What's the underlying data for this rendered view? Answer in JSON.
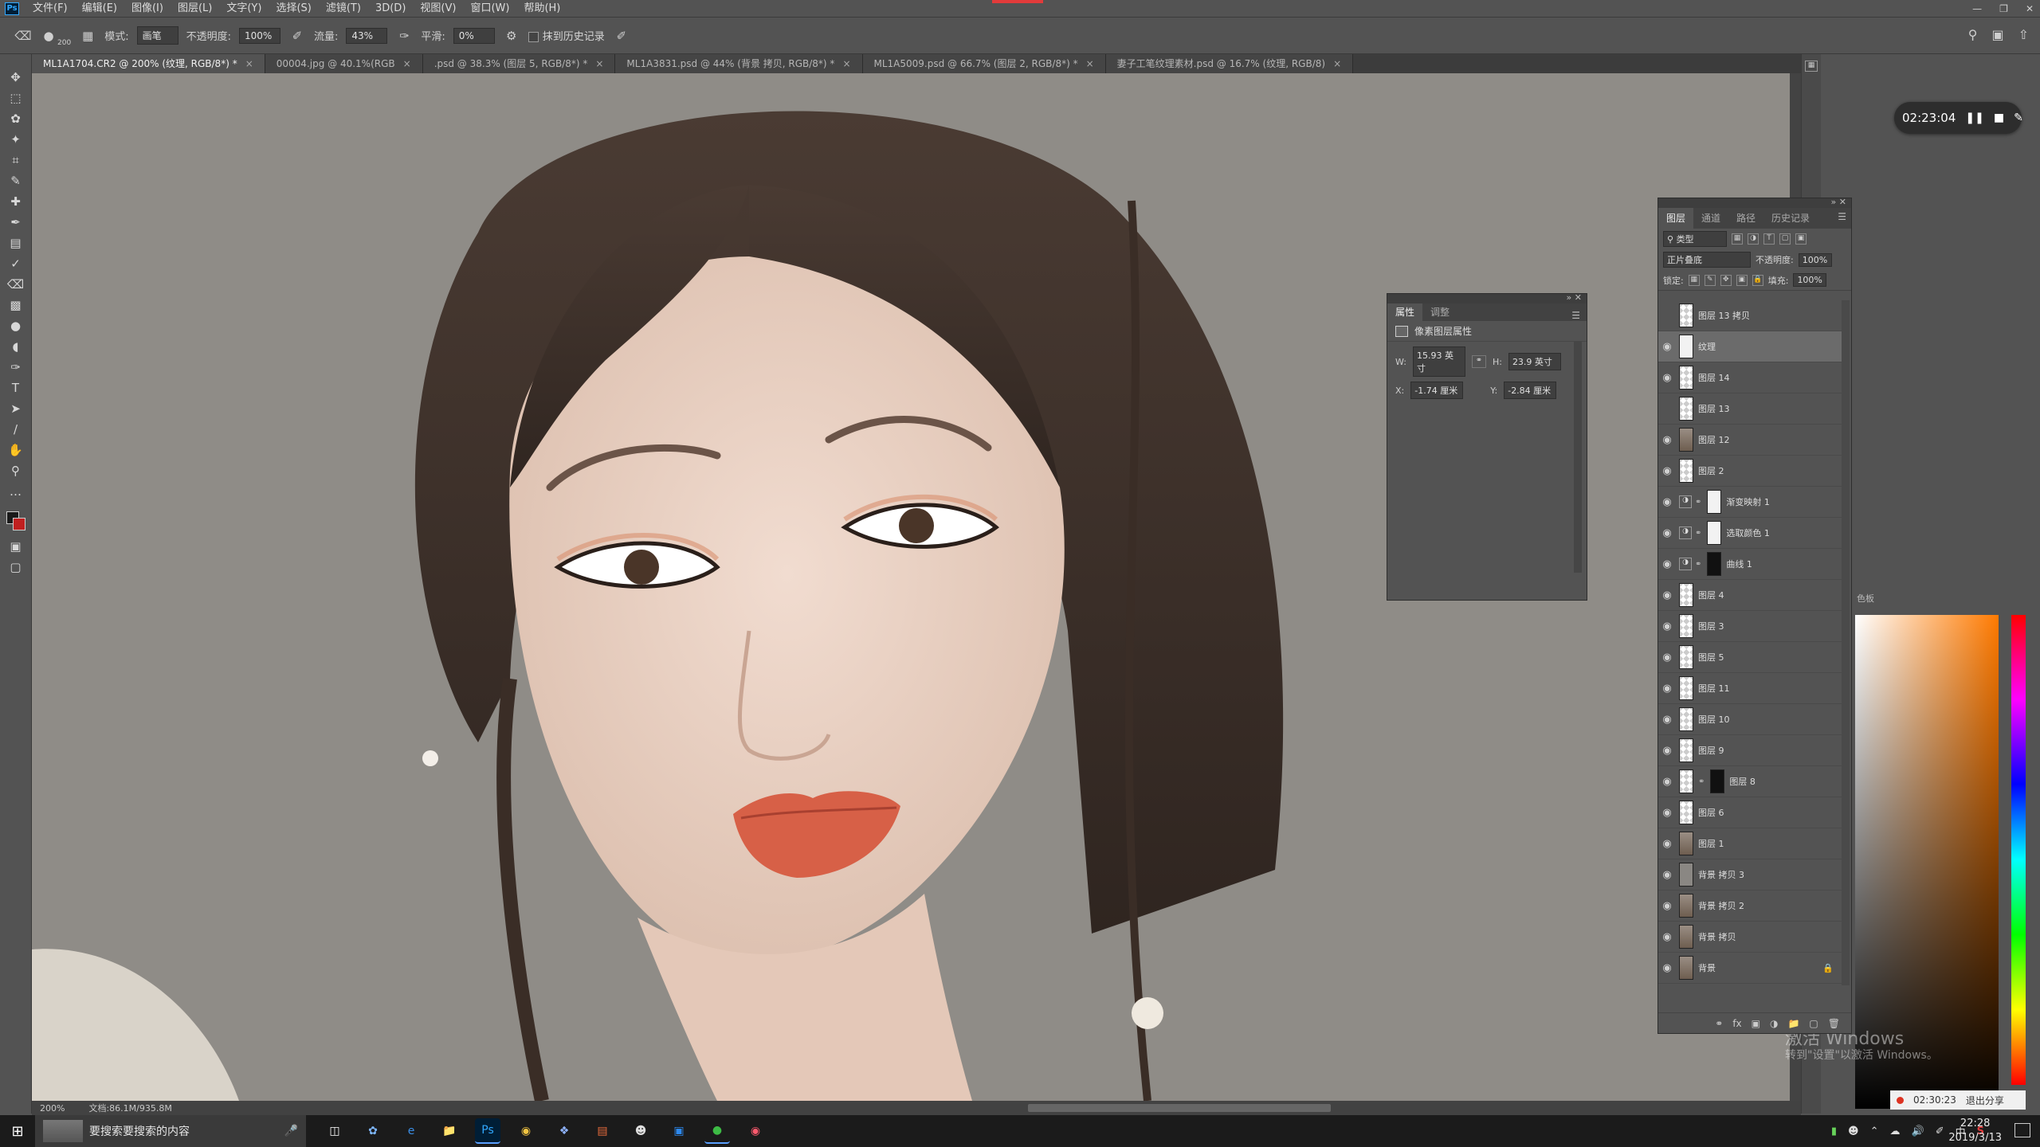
{
  "app": {
    "logo_text": "Ps",
    "menu": [
      "文件(F)",
      "编辑(E)",
      "图像(I)",
      "图层(L)",
      "文字(Y)",
      "选择(S)",
      "滤镜(T)",
      "3D(D)",
      "视图(V)",
      "窗口(W)",
      "帮助(H)"
    ]
  },
  "options": {
    "brush_size": "200",
    "mode_label": "模式:",
    "mode_value": "画笔",
    "opacity_label": "不透明度:",
    "opacity_value": "100%",
    "flow_label": "流量:",
    "flow_value": "43%",
    "smooth_label": "平滑:",
    "smooth_value": "0%",
    "history_label": "抹到历史记录"
  },
  "tabs": [
    {
      "label": "ML1A1704.CR2 @ 200% (纹理, RGB/8*) *",
      "active": true
    },
    {
      "label": "00004.jpg @ 40.1%(RGB",
      "active": false
    },
    {
      "label": ".psd @ 38.3% (图层 5, RGB/8*) *",
      "active": false
    },
    {
      "label": "ML1A3831.psd @ 44% (背景 拷贝, RGB/8*) *",
      "active": false
    },
    {
      "label": "ML1A5009.psd @ 66.7% (图层 2, RGB/8*) *",
      "active": false
    },
    {
      "label": "妻子工笔纹理素材.psd @ 16.7% (纹理, RGB/8)",
      "active": false
    }
  ],
  "status": {
    "zoom": "200%",
    "doc": "文档:86.1M/935.8M"
  },
  "properties": {
    "tab_props": "属性",
    "tab_adjust": "调整",
    "header": "像素图层属性",
    "w_label": "W:",
    "w_value": "15.93 英寸",
    "h_label": "H:",
    "h_value": "23.9 英寸",
    "x_label": "X:",
    "x_value": "-1.74 厘米",
    "y_label": "Y:",
    "y_value": "-2.84 厘米"
  },
  "layers_panel": {
    "tabs": [
      "图层",
      "通道",
      "路径",
      "历史记录"
    ],
    "filter_label": "类型",
    "blend_mode": "正片叠底",
    "opacity_label": "不透明度:",
    "opacity_value": "100%",
    "lock_label": "锁定:",
    "fill_label": "填充:",
    "fill_value": "100%",
    "layers": [
      {
        "name": "图层 13 拷贝",
        "visible": false,
        "thumb": "checker"
      },
      {
        "name": "纹理",
        "visible": true,
        "thumb": "white",
        "selected": true
      },
      {
        "name": "图层 14",
        "visible": true,
        "thumb": "checker"
      },
      {
        "name": "图层 13",
        "visible": false,
        "thumb": "checker"
      },
      {
        "name": "图层 12",
        "visible": true,
        "thumb": "photo"
      },
      {
        "name": "图层 2",
        "visible": true,
        "thumb": "checker"
      },
      {
        "name": "渐变映射 1",
        "visible": true,
        "thumb": "white",
        "adjust": "gradient"
      },
      {
        "name": "选取颜色 1",
        "visible": true,
        "thumb": "white",
        "adjust": "selective"
      },
      {
        "name": "曲线 1",
        "visible": true,
        "thumb": "black",
        "adjust": "curves"
      },
      {
        "name": "图层 4",
        "visible": true,
        "thumb": "checker"
      },
      {
        "name": "图层 3",
        "visible": true,
        "thumb": "checker"
      },
      {
        "name": "图层 5",
        "visible": true,
        "thumb": "checker"
      },
      {
        "name": "图层 11",
        "visible": true,
        "thumb": "checker"
      },
      {
        "name": "图层 10",
        "visible": true,
        "thumb": "checker"
      },
      {
        "name": "图层 9",
        "visible": true,
        "thumb": "checker"
      },
      {
        "name": "图层 8",
        "visible": true,
        "thumb": "checker",
        "mask": true
      },
      {
        "name": "图层 6",
        "visible": true,
        "thumb": "checker"
      },
      {
        "name": "图层 1",
        "visible": true,
        "thumb": "photo"
      },
      {
        "name": "背景 拷贝 3",
        "visible": true,
        "thumb": "gray"
      },
      {
        "name": "背景 拷贝 2",
        "visible": true,
        "thumb": "photo"
      },
      {
        "name": "背景 拷贝",
        "visible": true,
        "thumb": "photo"
      },
      {
        "name": "背景",
        "visible": true,
        "thumb": "photo",
        "locked": true
      }
    ]
  },
  "color_panel": {
    "label": "色板"
  },
  "recorder": {
    "timer": "02:23:04",
    "share_time": "02:30:23",
    "share_exit": "退出分享"
  },
  "activation": {
    "line1": "激活 Windows",
    "line2": "转到\"设置\"以激活 Windows。"
  },
  "taskbar": {
    "search_text": "要搜索要搜索的内容",
    "time": "22:28",
    "date": "2019/3/13",
    "ime": "中",
    "ime2": "S"
  },
  "colors": {
    "accent_red": "#e23b3b",
    "ps_blue": "#31a8ff",
    "canvas_gray": "#8a8783"
  }
}
